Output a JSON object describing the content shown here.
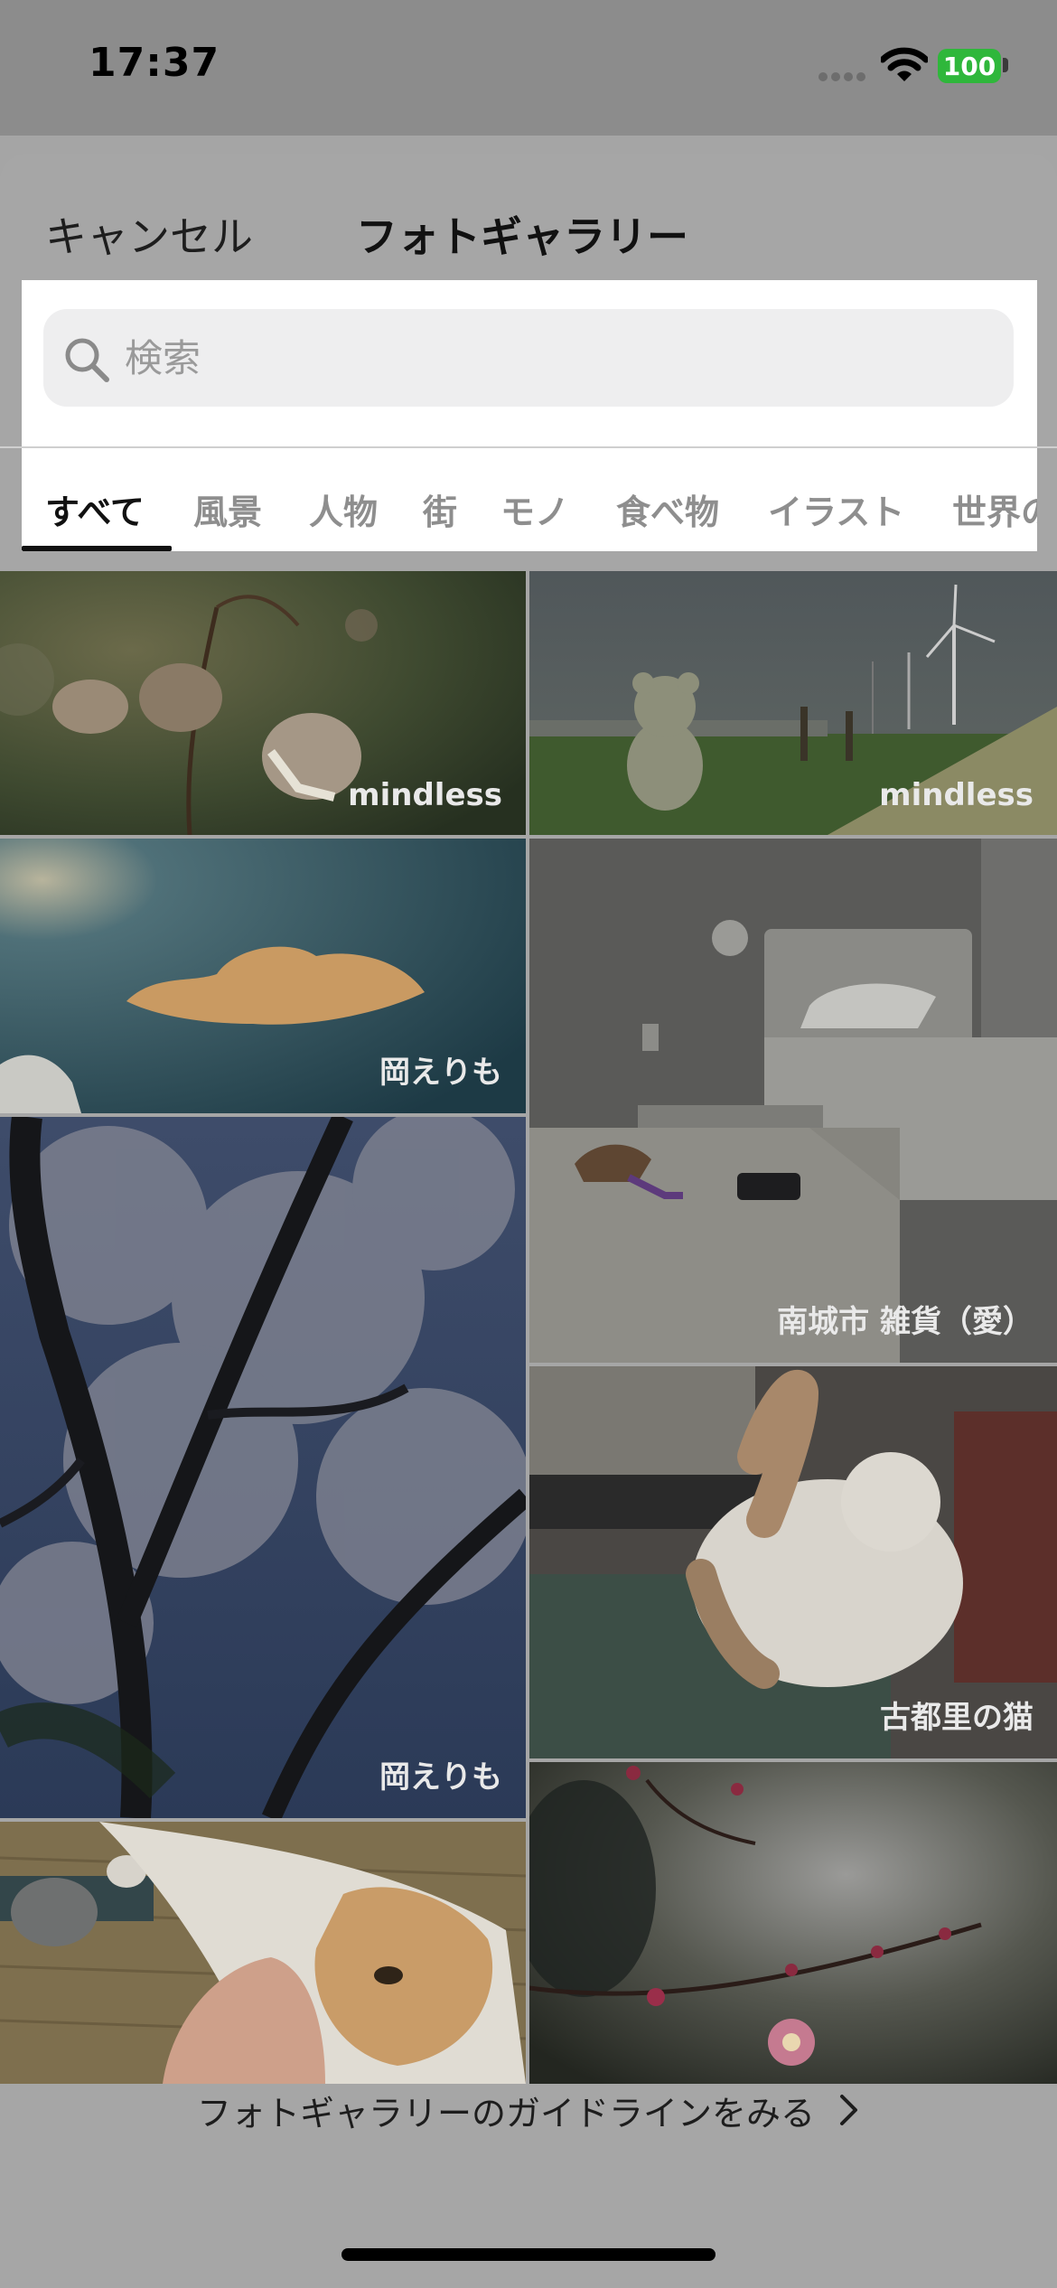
{
  "status_bar": {
    "time": "17:37",
    "battery": "100"
  },
  "sheet": {
    "cancel_label": "キャンセル",
    "title": "フォトギャラリー"
  },
  "search": {
    "placeholder": "検索"
  },
  "tabs": [
    {
      "label": "すべて",
      "active": true
    },
    {
      "label": "風景"
    },
    {
      "label": "人物"
    },
    {
      "label": "街"
    },
    {
      "label": "モノ"
    },
    {
      "label": "食べ物"
    },
    {
      "label": "イラスト"
    },
    {
      "label": "世界の"
    }
  ],
  "photos": [
    {
      "credit": "mindless",
      "subject": "withered-flowers"
    },
    {
      "credit": "mindless",
      "subject": "teddy-bear-wind-turbines"
    },
    {
      "credit": "岡えりも",
      "subject": "sky-cloud"
    },
    {
      "credit": "南城市 雑貨（愛）",
      "subject": "hermit-crab-hotel-room"
    },
    {
      "credit": "岡えりも",
      "subject": "cherry-blossom-tree"
    },
    {
      "credit": "古都里の猫",
      "subject": "cat-on-desk"
    },
    {
      "credit": "",
      "subject": "cat-with-hand"
    },
    {
      "credit": "",
      "subject": "plum-blossom"
    }
  ],
  "footer": {
    "guideline_label": "フォトギャラリーのガイドラインをみる"
  }
}
